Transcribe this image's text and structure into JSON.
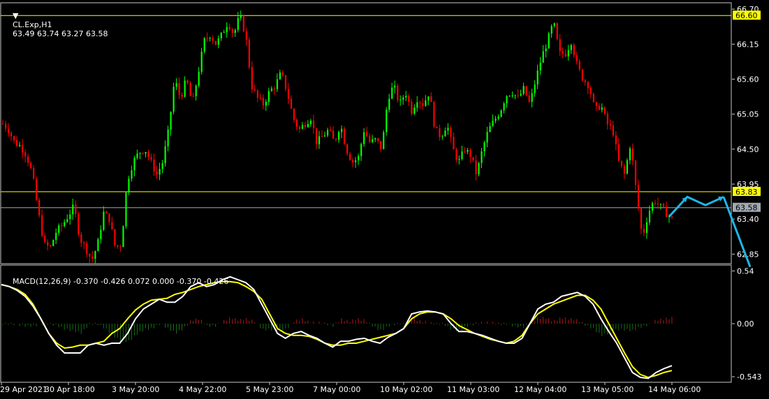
{
  "chart_data": [
    {
      "type": "candlestick",
      "symbol_header": "CL.Exp,H1",
      "ohlc_header": "63.49 63.74 63.27 63.58",
      "y_ticks": [
        "66.70",
        "66.15",
        "65.60",
        "65.05",
        "64.50",
        "63.95",
        "63.40",
        "62.85"
      ],
      "ylim": [
        62.7,
        66.8
      ],
      "levels": [
        {
          "name": "high",
          "value": 66.6,
          "label": "66.60",
          "color": "#ffff00",
          "text_color": "#000000"
        },
        {
          "name": "support",
          "value": 63.83,
          "label": "63.83",
          "color": "#ffff00",
          "text_color": "#000000"
        },
        {
          "name": "last",
          "value": 63.58,
          "label": "63.58",
          "color": "#a0a8b0",
          "text_color": "#000000"
        }
      ],
      "bull_color": "#00ff00",
      "bear_color": "#ff0000",
      "projection_color": "#1fb6e6",
      "projection": [
        63.44,
        63.75,
        63.62,
        63.75
      ],
      "projection_end": 62.65,
      "closes_path": [
        64.9,
        64.8,
        64.6,
        64.55,
        64.4,
        64.1,
        63.5,
        63.0,
        62.95,
        63.2,
        63.3,
        63.45,
        63.6,
        63.1,
        62.95,
        62.75,
        63.0,
        63.5,
        63.4,
        62.95,
        63.0,
        64.0,
        64.3,
        64.45,
        64.5,
        64.3,
        64.1,
        64.3,
        64.8,
        65.6,
        65.3,
        65.6,
        65.2,
        65.7,
        66.2,
        66.3,
        66.15,
        66.3,
        66.5,
        66.3,
        66.6,
        66.3,
        65.5,
        65.3,
        65.2,
        65.4,
        65.5,
        65.7,
        65.4,
        65.0,
        64.8,
        64.9,
        65.0,
        64.6,
        64.7,
        64.8,
        64.6,
        64.9,
        64.5,
        64.3,
        64.35,
        64.8,
        64.6,
        64.65,
        64.5,
        65.3,
        65.5,
        65.2,
        65.4,
        65.1,
        65.3,
        65.2,
        65.4,
        64.8,
        64.7,
        64.9,
        64.5,
        64.3,
        64.5,
        64.4,
        64.1,
        64.5,
        64.8,
        64.95,
        65.1,
        65.35,
        65.4,
        65.3,
        65.45,
        65.2,
        65.6,
        65.95,
        66.2,
        66.5,
        66.0,
        66.0,
        66.2,
        65.8,
        65.6,
        65.5,
        65.1,
        65.2,
        64.9,
        64.8,
        64.3,
        64.1,
        64.6,
        63.8,
        63.1,
        63.5,
        63.7,
        63.6,
        63.5,
        63.4
      ],
      "x_ticks": [
        "29 Apr 2021",
        "30 Apr 18:00",
        "3 May 20:00",
        "4 May 22:00",
        "5 May 23:00",
        "7 May 00:00",
        "10 May 02:00",
        "11 May 03:00",
        "12 May 04:00",
        "13 May 05:00",
        "14 May 06:00"
      ]
    },
    {
      "type": "macd",
      "header": "MACD(12,26,9) -0.370 -0.426 0.072 0.000 -0.370 -0.426",
      "y_ticks": [
        "0.54",
        "0.00",
        "-0.543"
      ],
      "ylim": [
        -0.6,
        0.6
      ],
      "macd_color": "#ffffff",
      "signal_color": "#ffff00",
      "hist_pos_color": "#b01818",
      "hist_neg_color": "#1b6b1b",
      "macd": [
        0.4,
        0.38,
        0.34,
        0.28,
        0.18,
        0.05,
        -0.1,
        -0.22,
        -0.3,
        -0.3,
        -0.3,
        -0.22,
        -0.2,
        -0.22,
        -0.2,
        -0.2,
        -0.1,
        0.05,
        0.15,
        0.2,
        0.25,
        0.22,
        0.22,
        0.28,
        0.38,
        0.42,
        0.38,
        0.4,
        0.45,
        0.48,
        0.45,
        0.42,
        0.35,
        0.2,
        0.05,
        -0.1,
        -0.15,
        -0.1,
        -0.08,
        -0.12,
        -0.15,
        -0.2,
        -0.24,
        -0.18,
        -0.18,
        -0.16,
        -0.15,
        -0.18,
        -0.2,
        -0.14,
        -0.1,
        -0.05,
        0.1,
        0.12,
        0.13,
        0.12,
        0.1,
        0.0,
        -0.08,
        -0.08,
        -0.1,
        -0.12,
        -0.15,
        -0.18,
        -0.2,
        -0.2,
        -0.15,
        0.0,
        0.15,
        0.2,
        0.22,
        0.28,
        0.3,
        0.32,
        0.28,
        0.2,
        0.05,
        -0.08,
        -0.2,
        -0.35,
        -0.5,
        -0.55,
        -0.56,
        -0.5,
        -0.46,
        -0.43
      ],
      "signal": [
        0.4,
        0.38,
        0.35,
        0.3,
        0.2,
        0.05,
        -0.1,
        -0.2,
        -0.25,
        -0.24,
        -0.22,
        -0.22,
        -0.2,
        -0.18,
        -0.1,
        -0.05,
        0.05,
        0.14,
        0.2,
        0.24,
        0.25,
        0.26,
        0.3,
        0.32,
        0.35,
        0.38,
        0.4,
        0.42,
        0.43,
        0.43,
        0.42,
        0.38,
        0.33,
        0.25,
        0.1,
        -0.05,
        -0.1,
        -0.12,
        -0.12,
        -0.13,
        -0.16,
        -0.2,
        -0.22,
        -0.22,
        -0.2,
        -0.2,
        -0.18,
        -0.16,
        -0.14,
        -0.12,
        -0.1,
        -0.05,
        0.05,
        0.1,
        0.12,
        0.12,
        0.1,
        0.05,
        -0.02,
        -0.06,
        -0.1,
        -0.13,
        -0.16,
        -0.18,
        -0.2,
        -0.18,
        -0.12,
        0.0,
        0.1,
        0.15,
        0.2,
        0.23,
        0.26,
        0.29,
        0.29,
        0.24,
        0.15,
        0.0,
        -0.15,
        -0.3,
        -0.44,
        -0.52,
        -0.55,
        -0.53,
        -0.5,
        -0.48
      ]
    }
  ]
}
